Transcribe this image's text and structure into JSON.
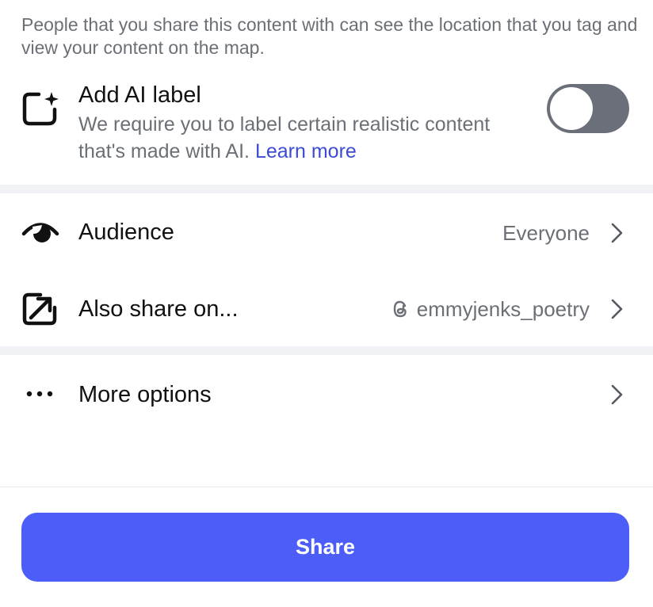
{
  "location_note": "People that you share this content with can see the location that you tag and view your content on the map.",
  "ai_label": {
    "title": "Add AI label",
    "description": "We require you to label certain realistic content that's made with AI.",
    "link": "Learn more",
    "toggle_on": false
  },
  "audience": {
    "label": "Audience",
    "value": "Everyone"
  },
  "also_share": {
    "label": "Also share on...",
    "value": "emmyjenks_poetry"
  },
  "more_options": {
    "label": "More options"
  },
  "share_button": {
    "label": "Share"
  },
  "colors": {
    "accent": "#4c5df8",
    "link": "#3b4bd3",
    "toggle_off": "#6a6f7a",
    "secondary_text": "#6b6f76",
    "divider": "#f0f2f5"
  },
  "icons": {
    "ai": "ai-label-sparkle-icon",
    "audience": "eye-icon",
    "also_share": "share-arrow-icon",
    "more": "more-dots-icon",
    "threads": "threads-icon",
    "chevron": "chevron-right-icon"
  }
}
